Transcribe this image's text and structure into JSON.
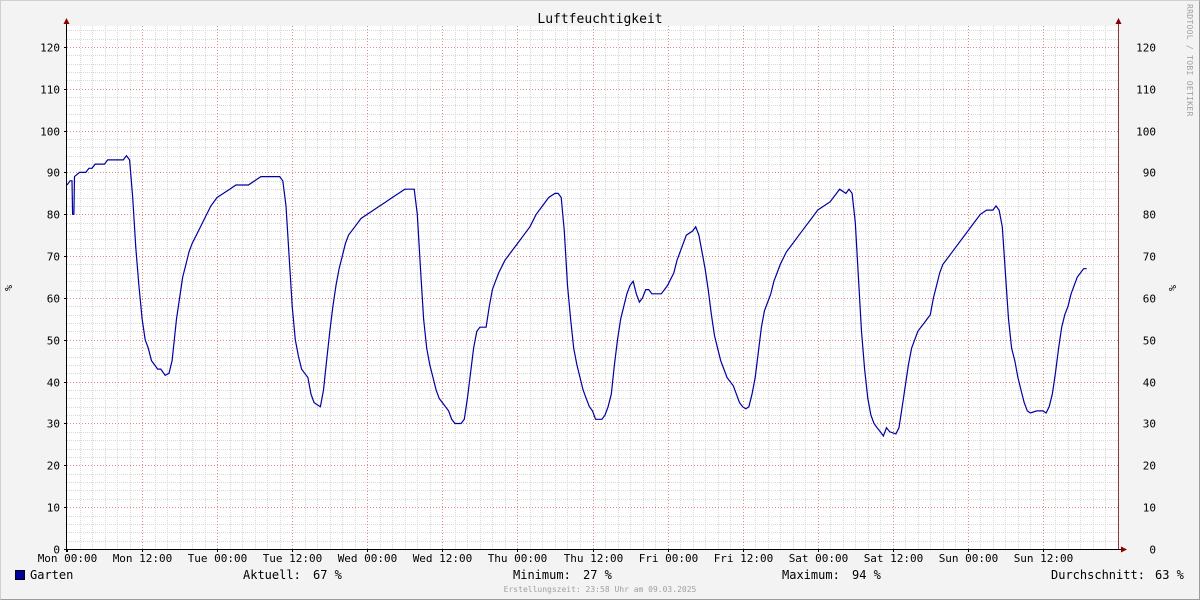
{
  "chart_data": {
    "type": "line",
    "title": "Luftfeuchtigkeit",
    "ylabel": "%",
    "ylabel_right": "%",
    "ylim": [
      0,
      125
    ],
    "yticks": [
      0,
      10,
      20,
      30,
      40,
      50,
      60,
      70,
      80,
      90,
      100,
      110,
      120
    ],
    "xlim_hours": [
      0,
      168
    ],
    "xticks": [
      {
        "h": 0,
        "label": "Mon 00:00"
      },
      {
        "h": 12,
        "label": "Mon 12:00"
      },
      {
        "h": 24,
        "label": "Tue 00:00"
      },
      {
        "h": 36,
        "label": "Tue 12:00"
      },
      {
        "h": 48,
        "label": "Wed 00:00"
      },
      {
        "h": 60,
        "label": "Wed 12:00"
      },
      {
        "h": 72,
        "label": "Thu 00:00"
      },
      {
        "h": 84,
        "label": "Thu 12:00"
      },
      {
        "h": 96,
        "label": "Fri 00:00"
      },
      {
        "h": 108,
        "label": "Fri 12:00"
      },
      {
        "h": 120,
        "label": "Sat 00:00"
      },
      {
        "h": 132,
        "label": "Sat 12:00"
      },
      {
        "h": 144,
        "label": "Sun 00:00"
      },
      {
        "h": 156,
        "label": "Sun 12:00"
      }
    ],
    "grid": true,
    "legend_position": "bottom-left",
    "series": [
      {
        "name": "Garten",
        "color": "#0000a0",
        "points": [
          [
            0,
            87
          ],
          [
            0.5,
            88
          ],
          [
            0.8,
            88
          ],
          [
            0.9,
            80
          ],
          [
            1.1,
            80
          ],
          [
            1.2,
            89
          ],
          [
            2,
            90
          ],
          [
            3,
            90
          ],
          [
            3.5,
            91
          ],
          [
            4,
            91
          ],
          [
            4.5,
            92
          ],
          [
            6,
            92
          ],
          [
            6.5,
            93
          ],
          [
            9,
            93
          ],
          [
            9.5,
            94
          ],
          [
            10,
            93
          ],
          [
            10.5,
            84
          ],
          [
            11,
            72
          ],
          [
            11.5,
            63
          ],
          [
            12,
            55
          ],
          [
            12.5,
            50
          ],
          [
            13,
            48
          ],
          [
            13.5,
            45
          ],
          [
            14,
            44
          ],
          [
            14.5,
            43
          ],
          [
            15,
            43
          ],
          [
            15.7,
            41.5
          ],
          [
            16.3,
            42
          ],
          [
            16.8,
            45
          ],
          [
            17.5,
            55
          ],
          [
            18,
            60
          ],
          [
            18.5,
            65
          ],
          [
            19,
            68
          ],
          [
            19.5,
            71
          ],
          [
            20,
            73
          ],
          [
            21,
            76
          ],
          [
            22,
            79
          ],
          [
            23,
            82
          ],
          [
            24,
            84
          ],
          [
            25,
            85
          ],
          [
            26,
            86
          ],
          [
            27,
            87
          ],
          [
            29,
            87
          ],
          [
            30,
            88
          ],
          [
            31,
            89
          ],
          [
            34,
            89
          ],
          [
            34.5,
            88
          ],
          [
            35,
            82
          ],
          [
            35.5,
            70
          ],
          [
            36,
            58
          ],
          [
            36.5,
            50
          ],
          [
            37,
            46
          ],
          [
            37.5,
            43
          ],
          [
            38,
            42
          ],
          [
            38.5,
            41
          ],
          [
            39,
            37
          ],
          [
            39.5,
            35
          ],
          [
            40,
            34.5
          ],
          [
            40.5,
            34
          ],
          [
            41,
            38
          ],
          [
            41.5,
            45
          ],
          [
            42,
            52
          ],
          [
            42.5,
            58
          ],
          [
            43,
            63
          ],
          [
            43.5,
            67
          ],
          [
            44,
            70
          ],
          [
            44.5,
            73
          ],
          [
            45,
            75
          ],
          [
            46,
            77
          ],
          [
            47,
            79
          ],
          [
            48,
            80
          ],
          [
            49,
            81
          ],
          [
            50,
            82
          ],
          [
            51,
            83
          ],
          [
            52,
            84
          ],
          [
            53,
            85
          ],
          [
            54,
            86
          ],
          [
            55.5,
            86
          ],
          [
            56,
            80
          ],
          [
            56.5,
            67
          ],
          [
            57,
            55
          ],
          [
            57.5,
            48
          ],
          [
            58,
            44
          ],
          [
            58.5,
            41
          ],
          [
            59,
            38
          ],
          [
            59.5,
            36
          ],
          [
            60,
            35
          ],
          [
            61,
            33
          ],
          [
            61.5,
            31
          ],
          [
            62,
            30
          ],
          [
            63,
            30
          ],
          [
            63.5,
            31
          ],
          [
            64,
            36
          ],
          [
            64.5,
            42
          ],
          [
            65,
            48
          ],
          [
            65.5,
            52
          ],
          [
            66,
            53
          ],
          [
            67,
            53
          ],
          [
            67.5,
            58
          ],
          [
            68,
            62
          ],
          [
            68.5,
            64
          ],
          [
            69,
            66
          ],
          [
            70,
            69
          ],
          [
            71,
            71
          ],
          [
            72,
            73
          ],
          [
            73,
            75
          ],
          [
            74,
            77
          ],
          [
            75,
            80
          ],
          [
            76,
            82
          ],
          [
            77,
            84
          ],
          [
            78,
            85
          ],
          [
            78.5,
            85
          ],
          [
            79,
            84
          ],
          [
            79.5,
            76
          ],
          [
            80,
            63
          ],
          [
            80.5,
            55
          ],
          [
            81,
            48
          ],
          [
            81.5,
            44
          ],
          [
            82,
            41
          ],
          [
            82.5,
            38
          ],
          [
            83,
            36
          ],
          [
            83.5,
            34
          ],
          [
            84,
            33
          ],
          [
            84.5,
            31
          ],
          [
            85.5,
            31
          ],
          [
            86,
            32
          ],
          [
            86.5,
            34
          ],
          [
            87,
            37
          ],
          [
            87.5,
            44
          ],
          [
            88,
            50
          ],
          [
            88.5,
            55
          ],
          [
            89,
            58
          ],
          [
            89.5,
            61
          ],
          [
            90,
            63
          ],
          [
            90.5,
            64
          ],
          [
            91,
            61
          ],
          [
            91.5,
            59
          ],
          [
            92,
            60
          ],
          [
            92.5,
            62
          ],
          [
            93,
            62
          ],
          [
            93.5,
            61
          ],
          [
            95,
            61
          ],
          [
            96,
            63
          ],
          [
            97,
            66
          ],
          [
            97.5,
            69
          ],
          [
            98,
            71
          ],
          [
            98.5,
            73
          ],
          [
            99,
            75
          ],
          [
            100,
            76
          ],
          [
            100.5,
            77
          ],
          [
            101,
            75
          ],
          [
            101.5,
            71
          ],
          [
            102,
            67
          ],
          [
            102.5,
            62
          ],
          [
            103,
            56
          ],
          [
            103.5,
            51
          ],
          [
            104,
            48
          ],
          [
            104.5,
            45
          ],
          [
            105,
            43
          ],
          [
            105.5,
            41
          ],
          [
            106,
            40
          ],
          [
            106.5,
            39
          ],
          [
            107,
            37
          ],
          [
            107.5,
            35
          ],
          [
            108,
            34
          ],
          [
            108.5,
            33.5
          ],
          [
            109,
            34
          ],
          [
            109.5,
            37
          ],
          [
            110,
            41
          ],
          [
            110.5,
            47
          ],
          [
            111,
            53
          ],
          [
            111.5,
            57
          ],
          [
            112,
            59
          ],
          [
            112.5,
            61
          ],
          [
            113,
            64
          ],
          [
            113.5,
            66
          ],
          [
            114,
            68
          ],
          [
            115,
            71
          ],
          [
            116,
            73
          ],
          [
            117,
            75
          ],
          [
            118,
            77
          ],
          [
            119,
            79
          ],
          [
            120,
            81
          ],
          [
            121,
            82
          ],
          [
            122,
            83
          ],
          [
            123,
            85
          ],
          [
            123.5,
            86
          ],
          [
            124.5,
            85
          ],
          [
            125,
            86
          ],
          [
            125.5,
            85
          ],
          [
            126,
            78
          ],
          [
            126.5,
            65
          ],
          [
            127,
            52
          ],
          [
            127.5,
            43
          ],
          [
            128,
            36
          ],
          [
            128.5,
            32
          ],
          [
            129,
            30
          ],
          [
            129.5,
            29
          ],
          [
            130,
            28
          ],
          [
            130.5,
            27
          ],
          [
            131,
            29
          ],
          [
            131.5,
            28
          ],
          [
            132.5,
            27.5
          ],
          [
            133,
            29
          ],
          [
            133.5,
            34
          ],
          [
            134,
            39
          ],
          [
            134.5,
            44
          ],
          [
            135,
            48
          ],
          [
            135.5,
            50
          ],
          [
            136,
            52
          ],
          [
            136.5,
            53
          ],
          [
            137,
            54
          ],
          [
            137.5,
            55
          ],
          [
            138,
            56
          ],
          [
            138.5,
            60
          ],
          [
            139,
            63
          ],
          [
            139.5,
            66
          ],
          [
            140,
            68
          ],
          [
            141,
            70
          ],
          [
            142,
            72
          ],
          [
            143,
            74
          ],
          [
            144,
            76
          ],
          [
            145,
            78
          ],
          [
            146,
            80
          ],
          [
            147,
            81
          ],
          [
            148,
            81
          ],
          [
            148.5,
            82
          ],
          [
            149,
            81
          ],
          [
            149.5,
            77
          ],
          [
            150,
            66
          ],
          [
            150.5,
            55
          ],
          [
            151,
            48
          ],
          [
            151.5,
            45
          ],
          [
            152,
            41
          ],
          [
            152.5,
            38
          ],
          [
            153,
            35
          ],
          [
            153.5,
            33
          ],
          [
            154,
            32.5
          ],
          [
            155,
            33
          ],
          [
            156,
            33
          ],
          [
            156.5,
            32.5
          ],
          [
            157,
            34
          ],
          [
            157.5,
            37
          ],
          [
            158,
            42
          ],
          [
            158.5,
            48
          ],
          [
            159,
            53
          ],
          [
            159.5,
            56
          ],
          [
            160,
            58
          ],
          [
            160.5,
            61
          ],
          [
            161,
            63
          ],
          [
            161.5,
            65
          ],
          [
            162,
            66
          ],
          [
            162.5,
            67
          ],
          [
            163,
            67
          ]
        ]
      }
    ]
  },
  "legend": {
    "series_name": "Garten",
    "current_label": "Aktuell:",
    "current_value": "67 %",
    "min_label": "Minimum:",
    "min_value": "27 %",
    "max_label": "Maximum:",
    "max_value": "94 %",
    "avg_label": "Durchschnitt:",
    "avg_value": "63 %"
  },
  "footer": "Erstellungszeit: 23:58 Uhr am 09.03.2025",
  "watermark": "RRDTOOL / TOBI OETIKER"
}
